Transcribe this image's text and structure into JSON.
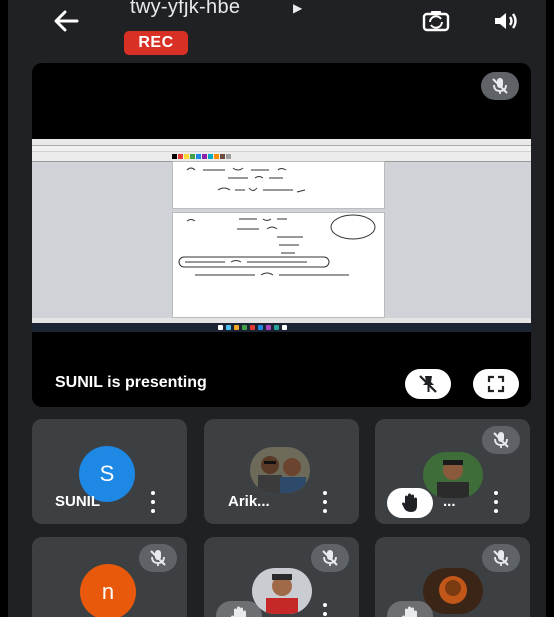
{
  "header": {
    "meeting_code": "twy-yfjk-hbe",
    "rec_label": "REC"
  },
  "presentation": {
    "presenting_text": "SUNIL is presenting"
  },
  "participants": [
    {
      "name": "SUNIL",
      "avatar_letter": "S",
      "avatar_color": "#1e88e5"
    },
    {
      "name": "Arik..."
    },
    {
      "name": "..."
    },
    {
      "avatar_letter": "n",
      "avatar_color": "#e8590c"
    }
  ],
  "colors": {
    "background": "#202124",
    "tile": "#3c4043",
    "rec_red": "#d93025",
    "mute_badge": "#5f6368"
  },
  "icons": [
    "back-arrow-icon",
    "caret-right-icon",
    "flip-camera-icon",
    "speaker-icon",
    "mic-off-icon",
    "pin-off-icon",
    "fullscreen-icon",
    "more-vert-icon",
    "raise-hand-icon"
  ]
}
